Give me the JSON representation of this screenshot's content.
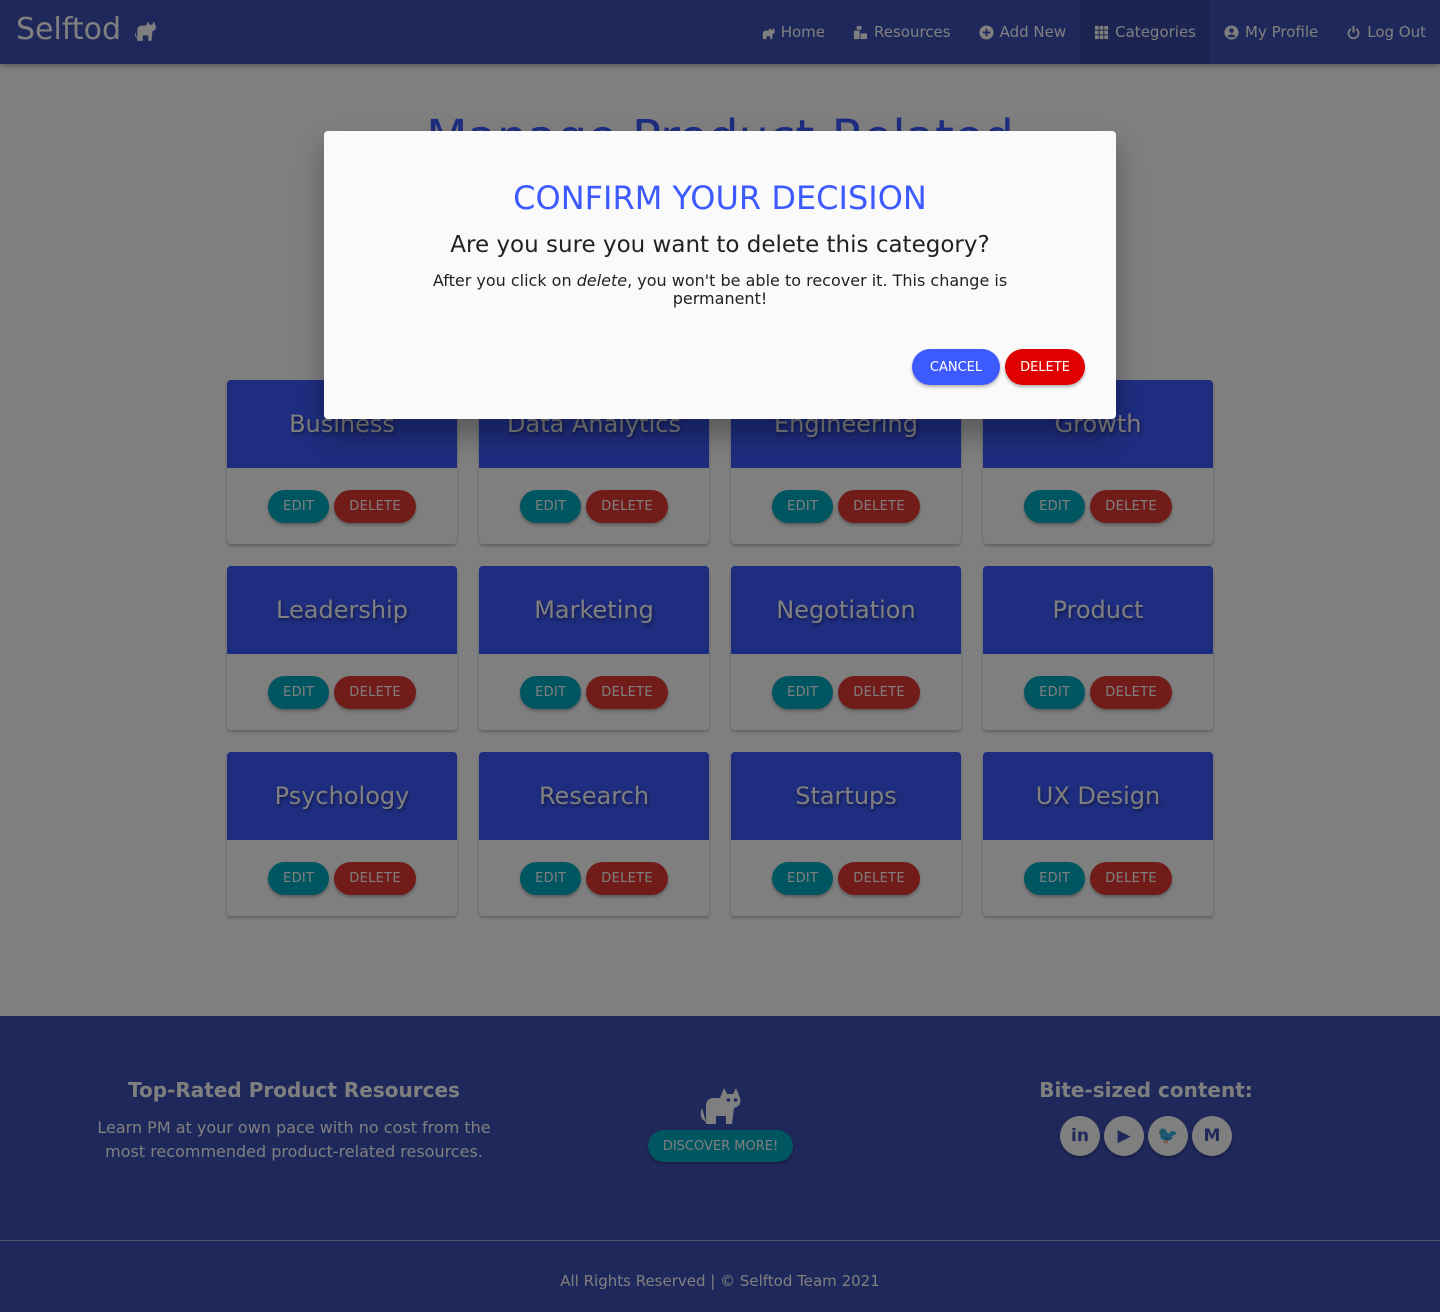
{
  "navbar": {
    "brand": "Selftod",
    "links": [
      {
        "label": "Home",
        "icon": "cat-icon"
      },
      {
        "label": "Resources",
        "icon": "resources-icon"
      },
      {
        "label": "Add New",
        "icon": "plus-circle-icon"
      },
      {
        "label": "Categories",
        "icon": "grid-icon",
        "active": true
      },
      {
        "label": "My Profile",
        "icon": "user-circle-icon"
      },
      {
        "label": "Log Out",
        "icon": "power-icon"
      }
    ]
  },
  "main": {
    "title": "Manage Product-Related",
    "edit_label": "EDIT",
    "delete_label": "DELETE",
    "categories": [
      {
        "name": "Business"
      },
      {
        "name": "Data Analytics"
      },
      {
        "name": "Engineering"
      },
      {
        "name": "Growth"
      },
      {
        "name": "Leadership"
      },
      {
        "name": "Marketing"
      },
      {
        "name": "Negotiation"
      },
      {
        "name": "Product"
      },
      {
        "name": "Psychology"
      },
      {
        "name": "Research"
      },
      {
        "name": "Startups"
      },
      {
        "name": "UX Design"
      }
    ]
  },
  "modal": {
    "title": "CONFIRM YOUR DECISION",
    "question": "Are you sure you want to delete this category?",
    "body_before": "After you click on ",
    "body_emphasis": "delete",
    "body_after": ", you won't be able to recover it. This change is permanent!",
    "cancel_label": "CANCEL",
    "delete_label": "DELETE"
  },
  "footer": {
    "left_title": "Top-Rated Product Resources",
    "left_text": "Learn PM at your own pace with no cost from the most recommended product-related resources.",
    "discover_label": "DISCOVER MORE!",
    "right_title": "Bite-sized content:",
    "socials": [
      {
        "label": "in",
        "icon": "linkedin-icon"
      },
      {
        "label": "▶",
        "icon": "youtube-icon"
      },
      {
        "label": "🐦",
        "icon": "twitter-icon"
      },
      {
        "label": "M",
        "icon": "medium-icon"
      }
    ],
    "copyright": "All Rights Reserved | © Selftod Team 2021"
  },
  "colors": {
    "navbar": "#3f51b5",
    "accent": "#3d5afe",
    "edit": "#00acc1",
    "delete": "#e53935",
    "modal_delete": "#e00000"
  }
}
